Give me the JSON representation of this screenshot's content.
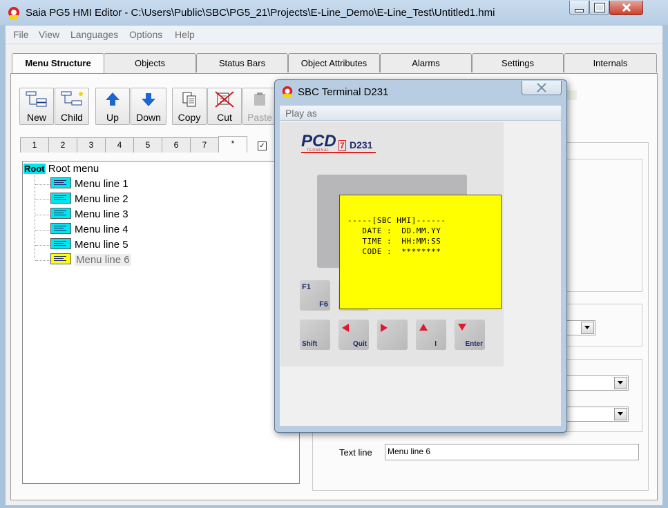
{
  "window": {
    "title": "Saia PG5 HMI Editor - C:\\Users\\Public\\SBC\\PG5_21\\Projects\\E-Line_Demo\\E-Line_Test\\Untitled1.hmi",
    "minimize_icon": "minimize-icon",
    "maximize_icon": "maximize-icon",
    "close_icon": "close-icon"
  },
  "menubar": [
    "File",
    "View",
    "Languages",
    "Options",
    "Help"
  ],
  "tabs": [
    {
      "label": "Menu Structure",
      "active": true
    },
    {
      "label": "Objects"
    },
    {
      "label": "Status Bars"
    },
    {
      "label": "Object Attributes"
    },
    {
      "label": "Alarms"
    },
    {
      "label": "Settings"
    },
    {
      "label": "Internals"
    }
  ],
  "toolbar": {
    "new": "New",
    "child": "Child",
    "up": "Up",
    "down": "Down",
    "copy": "Copy",
    "cut": "Cut",
    "paste": "Paste"
  },
  "levels": [
    "1",
    "2",
    "3",
    "4",
    "5",
    "6",
    "7",
    "*"
  ],
  "tree": {
    "root_tag": "Root",
    "root_label": "Root menu",
    "items": [
      "Menu line 1",
      "Menu line 2",
      "Menu line 3",
      "Menu line 4",
      "Menu line 5",
      "Menu line 6"
    ],
    "selected_index": 5
  },
  "properties": {
    "text_line_label": "Text line",
    "text_line_value": "Menu line 6"
  },
  "dialog": {
    "title": "SBC Terminal D231",
    "menu": "Play as",
    "logo_pcd": "PCD",
    "logo_small": "TERMINAL",
    "logo_7": "7",
    "logo_model": "D231",
    "lcd_lines": [
      "-----[SBC HMI]------",
      "   DATE :  DD.MM.YY",
      "   TIME :  HH:MM:SS",
      "   CODE :  ********"
    ],
    "keys": {
      "f1": "F1",
      "f6": "F6",
      "shift": "Shift",
      "quit": "Quit",
      "i": "I",
      "enter": "Enter"
    }
  },
  "colors": {
    "lcd": "#ffff00",
    "tree_icon": "#00e5ee",
    "tree_icon_selected": "#ffff00",
    "key_arrow": "#e0192f"
  }
}
